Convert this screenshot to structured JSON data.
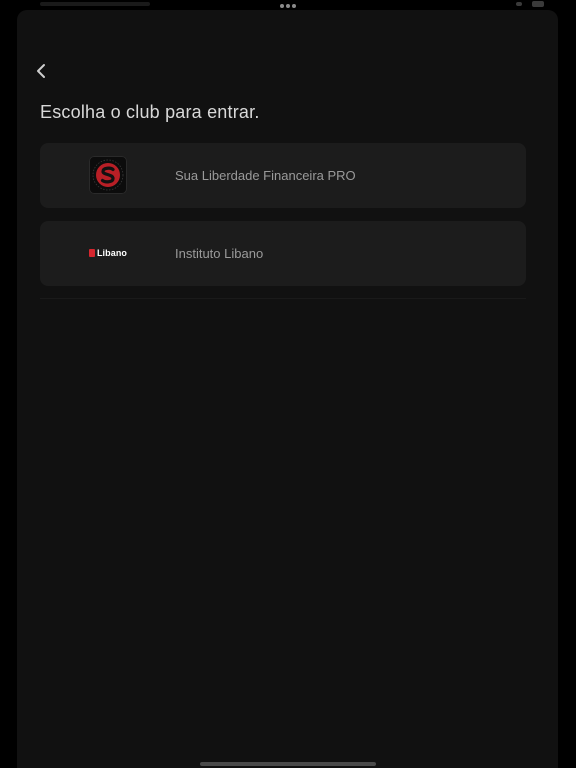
{
  "header": {
    "title": "Escolha o club para entrar.",
    "back_icon": "chevron-left-icon"
  },
  "clubs": [
    {
      "name": "Sua Liberdade Financeira PRO",
      "logo_icon": "s-logo-icon",
      "logo_color": "#d6262e"
    },
    {
      "name": "Instituto Libano",
      "logo_icon": "libano-logo-icon",
      "logo_text": "Libano",
      "logo_color": "#d6262e"
    }
  ],
  "colors": {
    "background": "#111111",
    "card": "#1c1c1c",
    "title_text": "#d9d9d9",
    "card_text": "#9a9a9a",
    "brand_red": "#d6262e"
  }
}
